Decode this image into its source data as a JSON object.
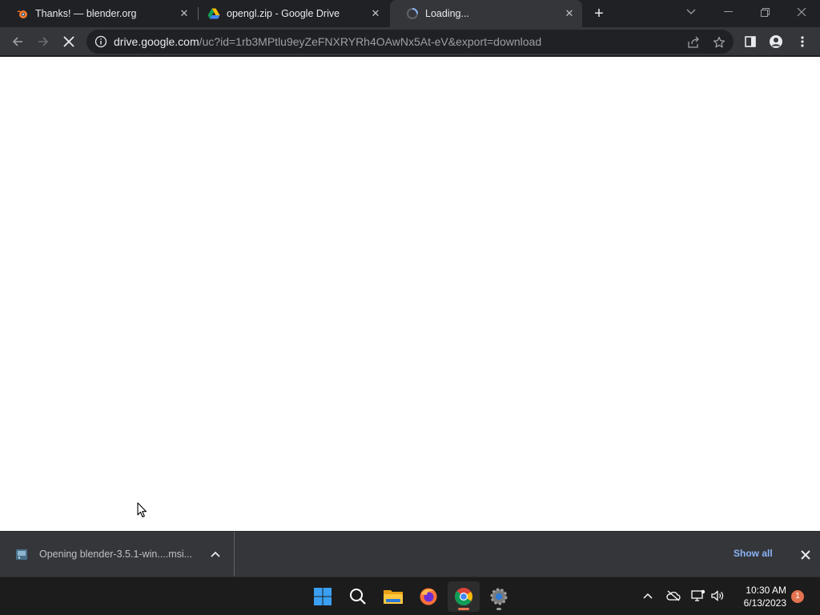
{
  "browser": {
    "tabs": [
      {
        "title": "Thanks! — blender.org",
        "favicon": "blender-icon",
        "active": false
      },
      {
        "title": "opengl.zip - Google Drive",
        "favicon": "google-drive-icon",
        "active": false
      },
      {
        "title": "Loading...",
        "favicon": "loading-spinner-icon",
        "active": true
      }
    ],
    "address": {
      "host": "drive.google.com",
      "path": "/uc?id=1rb3MPtlu9eyZeFNXRYRh4OAwNx5At-eV&export=download"
    }
  },
  "download_shelf": {
    "item_label": "Opening blender-3.5.1-win....msi...",
    "show_all_label": "Show all"
  },
  "taskbar": {
    "time": "10:30 AM",
    "date": "6/13/2023",
    "notification_count": "1"
  },
  "colors": {
    "tab_strip": "#202124",
    "toolbar": "#35363a",
    "link_blue": "#8ab4f8",
    "page_background": "#ffffff"
  }
}
